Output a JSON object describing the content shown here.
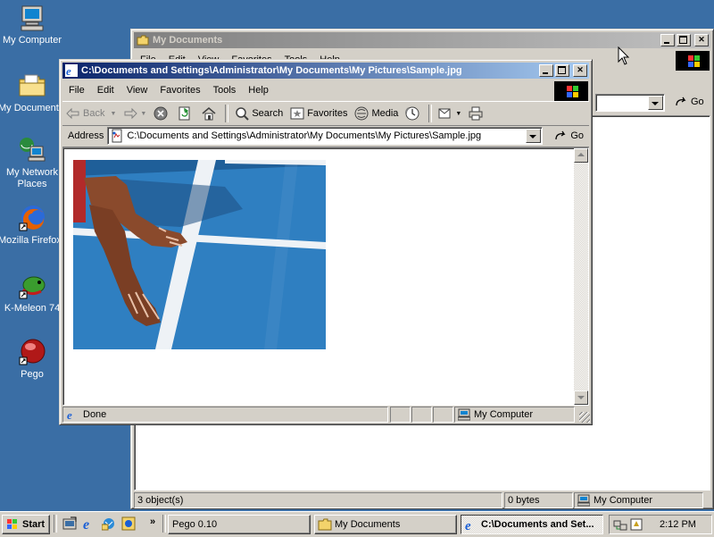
{
  "desktop": {
    "icons": [
      {
        "label": "My Computer"
      },
      {
        "label": "My Documents"
      },
      {
        "label": "My Network Places"
      },
      {
        "label": "Mozilla Firefox"
      },
      {
        "label": "K-Meleon 74"
      },
      {
        "label": "Pego"
      }
    ]
  },
  "back_window": {
    "title": "My Documents",
    "menu": [
      "File",
      "Edit",
      "View",
      "Favorites",
      "Tools",
      "Help"
    ],
    "go_label": "Go",
    "status": {
      "objects": "3 object(s)",
      "size": "0 bytes",
      "zone": "My Computer"
    }
  },
  "front_window": {
    "title": "C:\\Documents and Settings\\Administrator\\My Documents\\My Pictures\\Sample.jpg",
    "menu": [
      "File",
      "Edit",
      "View",
      "Favorites",
      "Tools",
      "Help"
    ],
    "toolbar": {
      "back": "Back",
      "search": "Search",
      "favorites": "Favorites",
      "media": "Media"
    },
    "address_label": "Address",
    "address_value": "C:\\Documents and Settings\\Administrator\\My Documents\\My Pictures\\Sample.jpg",
    "go_label": "Go",
    "status": {
      "text": "Done",
      "zone": "My Computer"
    }
  },
  "taskbar": {
    "start_label": "Start",
    "tasks": [
      {
        "label": "Pego 0.10"
      },
      {
        "label": "My Documents"
      },
      {
        "label": "C:\\Documents and Set..."
      }
    ],
    "clock": "2:12 PM"
  }
}
